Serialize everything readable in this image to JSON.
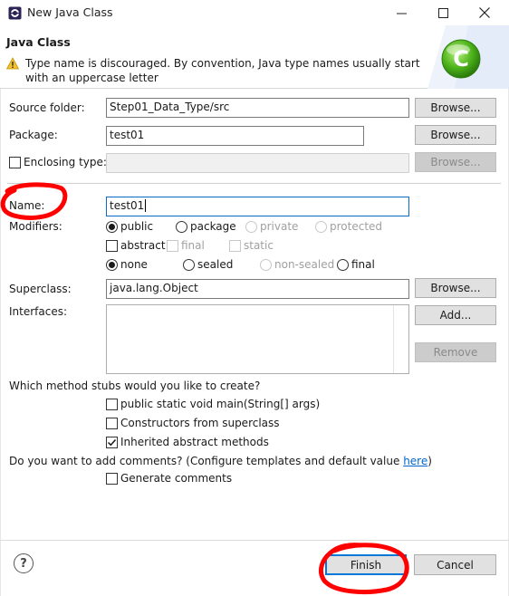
{
  "window": {
    "title": "New Java Class"
  },
  "header": {
    "title": "Java Class",
    "message": "Type name is discouraged. By convention, Java type names usually start with an uppercase letter",
    "logo_letter": "C"
  },
  "form": {
    "source_folder": {
      "label": "Source folder:",
      "value": "Step01_Data_Type/src",
      "button": "Browse..."
    },
    "package": {
      "label": "Package:",
      "value": "test01",
      "button": "Browse..."
    },
    "enclosing_type": {
      "label": "Enclosing type:",
      "value": "",
      "button": "Browse...",
      "checked": false
    },
    "name": {
      "label": "Name:",
      "value": "test01"
    },
    "modifiers": {
      "label": "Modifiers:",
      "access": [
        "public",
        "package",
        "private",
        "protected"
      ],
      "access_selected": "public",
      "other": [
        "abstract",
        "final",
        "static"
      ],
      "sealing": [
        "none",
        "sealed",
        "non-sealed",
        "final"
      ],
      "sealing_selected": "none"
    },
    "superclass": {
      "label": "Superclass:",
      "value": "java.lang.Object",
      "button": "Browse..."
    },
    "interfaces": {
      "label": "Interfaces:",
      "add_button": "Add...",
      "remove_button": "Remove"
    },
    "stubs": {
      "question": "Which method stubs would you like to create?",
      "items": [
        {
          "label": "public static void main(String[] args)",
          "checked": false
        },
        {
          "label": "Constructors from superclass",
          "checked": false
        },
        {
          "label": "Inherited abstract methods",
          "checked": true
        }
      ]
    },
    "comments": {
      "question_prefix": "Do you want to add comments? (Configure templates and default value ",
      "link": "here",
      "question_suffix": ")",
      "checkbox": "Generate comments"
    }
  },
  "footer": {
    "help": "?",
    "finish": "Finish",
    "cancel": "Cancel"
  },
  "colors": {
    "annotation": "#ff0000",
    "focus": "#0b6cc7",
    "link": "#0066cc"
  }
}
